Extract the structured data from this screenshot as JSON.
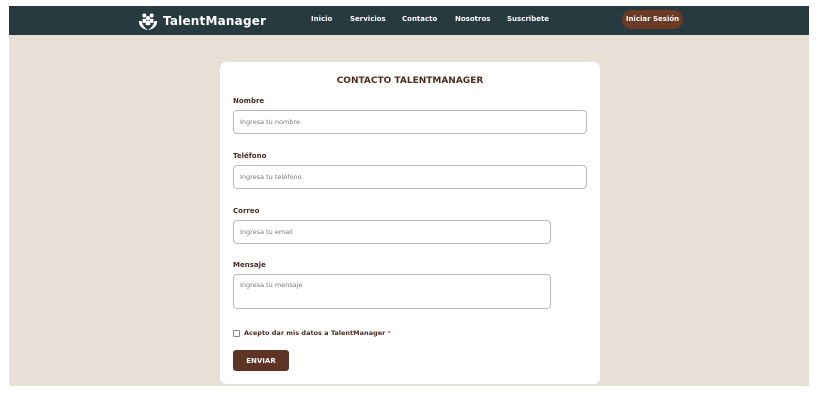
{
  "brand": {
    "name": "TalentManager",
    "logo_icon": "people-hands-icon"
  },
  "nav": {
    "links": [
      "Inicio",
      "Servicios",
      "Contacto",
      "Nosotros",
      "Suscribete"
    ],
    "login_label": "Iniciar Sesión"
  },
  "form": {
    "title": "CONTACTO TALENTMANAGER",
    "name": {
      "label": "Nombre",
      "placeholder": "Ingresa tu nombre",
      "value": ""
    },
    "phone": {
      "label": "Teléfono",
      "placeholder": "Ingresa tu teléfono",
      "value": ""
    },
    "email": {
      "label": "Correo",
      "placeholder": "Ingresa tu email",
      "value": ""
    },
    "message": {
      "label": "Mensaje",
      "placeholder": "Ingresa tu mensaje",
      "value": ""
    },
    "consent": {
      "label": "Acepto dar mis datos a TalentManager",
      "required_mark": "*",
      "checked": false
    },
    "submit_label": "ENVIAR"
  },
  "colors": {
    "navbar": "#263a40",
    "page_bg": "#e8dfd6",
    "accent_brown": "#5e3424",
    "label_brown": "#4a2c20",
    "required_red": "#c0392b"
  }
}
